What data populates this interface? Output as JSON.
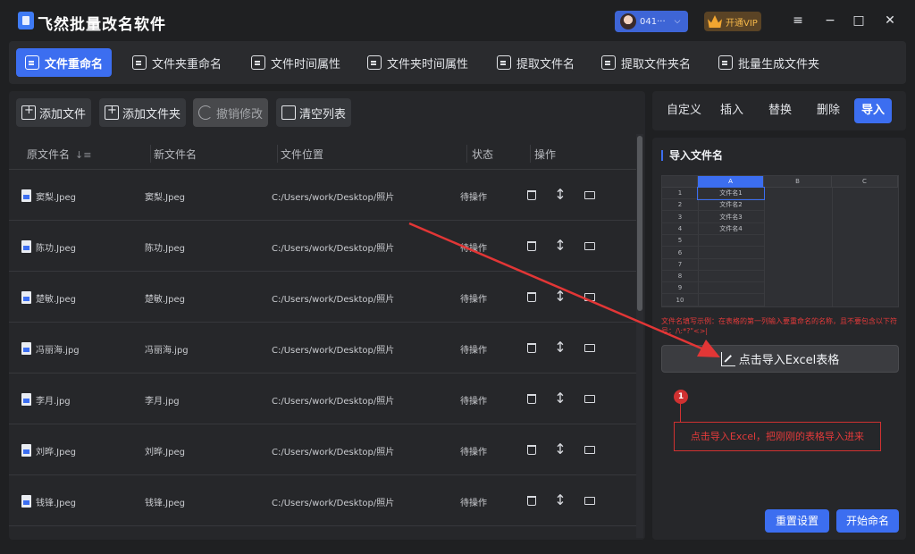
{
  "app": {
    "title": "飞然批量改名软件",
    "user_name": "041···",
    "vip_label": "开通VIP"
  },
  "window_controls": {
    "menu": "≡",
    "minimize": "−",
    "maximize": "□",
    "close": "✕"
  },
  "nav_tabs": [
    {
      "label": "文件重命名",
      "icon": "file-rename-icon",
      "active": true
    },
    {
      "label": "文件夹重命名",
      "icon": "terminal-icon",
      "active": false
    },
    {
      "label": "文件时间属性",
      "icon": "clock-file-icon",
      "active": false
    },
    {
      "label": "文件夹时间属性",
      "icon": "clock-folder-icon",
      "active": false
    },
    {
      "label": "提取文件名",
      "icon": "extract-file-icon",
      "active": false
    },
    {
      "label": "提取文件夹名",
      "icon": "upload-folder-icon",
      "active": false
    },
    {
      "label": "批量生成文件夹",
      "icon": "gear-folder-icon",
      "active": false
    }
  ],
  "toolbar": {
    "add_file": "添加文件",
    "add_folder": "添加文件夹",
    "undo": "撤销修改",
    "clear": "清空列表"
  },
  "table": {
    "headers": {
      "original": "原文件名",
      "new": "新文件名",
      "location": "文件位置",
      "status": "状态",
      "actions": "操作"
    },
    "rows": [
      {
        "original": "窦梨.Jpeg",
        "new": "窦梨.Jpeg",
        "location": "C:/Users/work/Desktop/照片",
        "status": "待操作"
      },
      {
        "original": "陈功.Jpeg",
        "new": "陈功.Jpeg",
        "location": "C:/Users/work/Desktop/照片",
        "status": "待操作"
      },
      {
        "original": "楚敏.Jpeg",
        "new": "楚敏.Jpeg",
        "location": "C:/Users/work/Desktop/照片",
        "status": "待操作"
      },
      {
        "original": "冯丽海.jpg",
        "new": "冯丽海.jpg",
        "location": "C:/Users/work/Desktop/照片",
        "status": "待操作"
      },
      {
        "original": "李月.jpg",
        "new": "李月.jpg",
        "location": "C:/Users/work/Desktop/照片",
        "status": "待操作"
      },
      {
        "original": "刘晔.Jpeg",
        "new": "刘晔.Jpeg",
        "location": "C:/Users/work/Desktop/照片",
        "status": "待操作"
      },
      {
        "original": "钱锋.Jpeg",
        "new": "钱锋.Jpeg",
        "location": "C:/Users/work/Desktop/照片",
        "status": "待操作"
      }
    ]
  },
  "right_tabs": [
    {
      "label": "自定义",
      "active": false
    },
    {
      "label": "插入",
      "active": false
    },
    {
      "label": "替换",
      "active": false
    },
    {
      "label": "删除",
      "active": false
    },
    {
      "label": "导入",
      "active": true
    }
  ],
  "import_panel": {
    "title": "导入文件名",
    "sheet": {
      "columns": [
        "A",
        "B",
        "C"
      ],
      "rows": [
        "1",
        "2",
        "3",
        "4",
        "5",
        "6",
        "7",
        "8",
        "9",
        "10"
      ],
      "values": [
        "文件名1",
        "文件名2",
        "文件名3",
        "文件名4"
      ]
    },
    "hint": "文件名填写示例：在表格的第一列输入要重命名的名称，且不要包含以下符号：/\\:*?\"<>|",
    "import_button": "点击导入Excel表格",
    "step_number": "1",
    "callout": "点击导入Excel，把刚刚的表格导入进来",
    "reset_button": "重置设置",
    "start_button": "开始命名"
  },
  "colors": {
    "accent": "#3c6ef0",
    "background": "#1f2022",
    "panel": "#26272a",
    "annotation_red": "#d03131",
    "vip_gold": "#f2a630"
  }
}
